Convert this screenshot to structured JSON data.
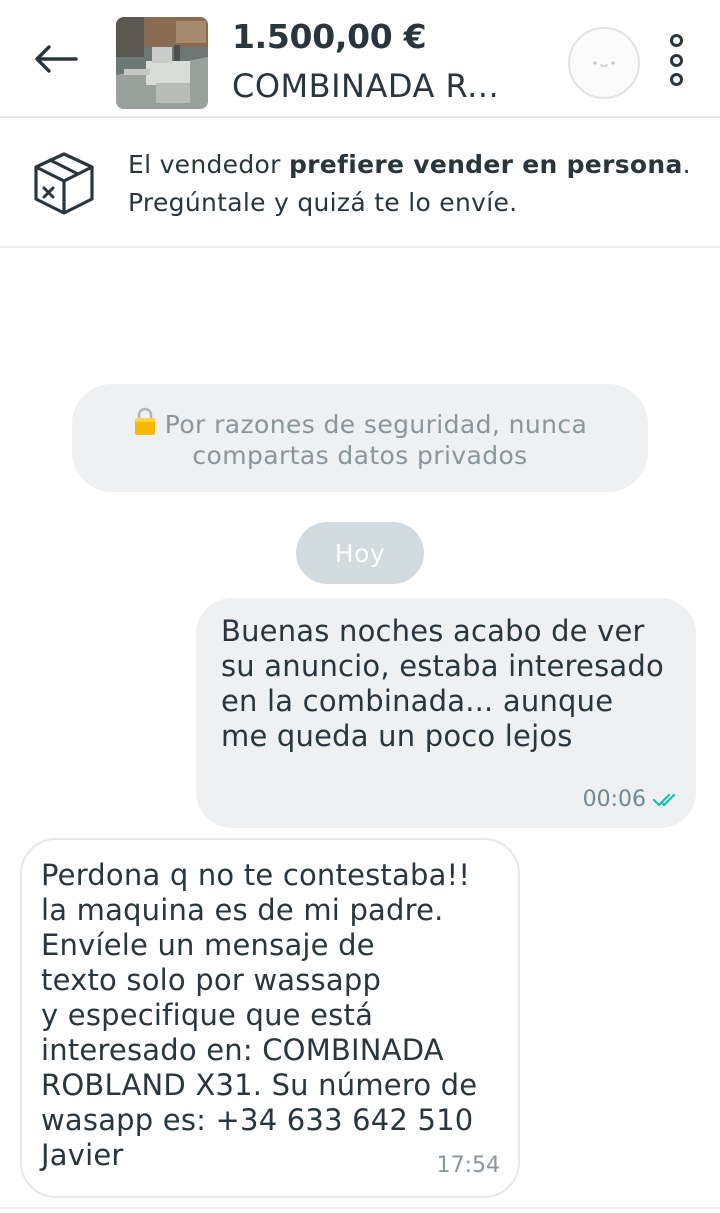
{
  "header": {
    "back_icon": "arrow-left-icon",
    "price": "1.500,00 €",
    "title": "COMBINADA R...",
    "avatar_icon": "smiley-avatar",
    "more_icon": "vertical-dots-icon"
  },
  "notice": {
    "icon": "box-x-icon",
    "text_prefix": "El vendedor ",
    "text_bold": "prefiere vender en persona",
    "text_suffix": ".",
    "line2": "Pregúntale y quizá te lo envíe."
  },
  "security_banner": {
    "icon": "lock-icon",
    "text": "Por razones de seguridad, nunca compartas datos privados"
  },
  "date_separator": "Hoy",
  "messages": [
    {
      "direction": "outgoing",
      "text": "Buenas noches acabo de ver\nsu anuncio, estaba interesado\nen la combinada... aunque\nme queda un poco lejos",
      "time": "00:06",
      "status_icon": "double-check-icon",
      "status_color": "#13c1ac"
    },
    {
      "direction": "incoming",
      "text": "Perdona q no te contestaba!!\nla maquina es de mi padre.\nEnvíele un mensaje de\ntexto solo por wassapp\ny especifique que está\ninteresado en: COMBINADA\nROBLAND X31. Su número de\nwasapp es: +34 633 642 510\nJavier",
      "time": "17:54"
    }
  ],
  "colors": {
    "text": "#29363d",
    "bubble_out": "#eef0f1",
    "date_pill": "#d2dbdf",
    "accent": "#13c1ac"
  }
}
